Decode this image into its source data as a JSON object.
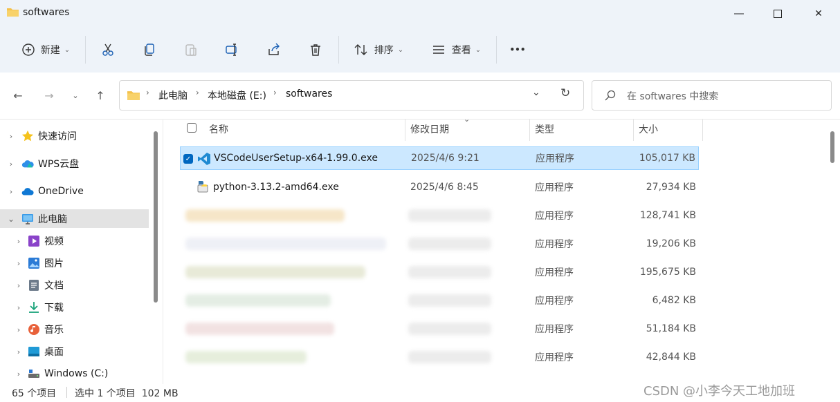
{
  "window": {
    "title": "softwares"
  },
  "toolbar": {
    "new_label": "新建",
    "sort_label": "排序",
    "view_label": "查看",
    "more_label": "•••"
  },
  "address": {
    "crumbs": [
      "此电脑",
      "本地磁盘 (E:)",
      "softwares"
    ],
    "search_placeholder": "在 softwares 中搜索"
  },
  "sidebar": {
    "items": [
      {
        "label": "快速访问",
        "icon": "star-icon"
      },
      {
        "label": "WPS云盘",
        "icon": "cloud-icon"
      },
      {
        "label": "OneDrive",
        "icon": "onedrive-icon"
      },
      {
        "label": "此电脑",
        "icon": "computer-icon"
      },
      {
        "label": "视频",
        "icon": "video-icon"
      },
      {
        "label": "图片",
        "icon": "picture-icon"
      },
      {
        "label": "文档",
        "icon": "document-icon"
      },
      {
        "label": "下载",
        "icon": "download-icon"
      },
      {
        "label": "音乐",
        "icon": "music-icon"
      },
      {
        "label": "桌面",
        "icon": "desktop-icon"
      },
      {
        "label": "Windows (C:)",
        "icon": "drive-icon"
      }
    ]
  },
  "columns": {
    "name": "名称",
    "date": "修改日期",
    "type": "类型",
    "size": "大小"
  },
  "files": [
    {
      "name": "VSCodeUserSetup-x64-1.99.0.exe",
      "date": "2025/4/6 9:21",
      "type": "应用程序",
      "size": "105,017 KB",
      "selected": true
    },
    {
      "name": "python-3.13.2-amd64.exe",
      "date": "2025/4/6 8:45",
      "type": "应用程序",
      "size": "27,934 KB",
      "selected": false
    },
    {
      "name": "",
      "date": "",
      "type": "应用程序",
      "size": "128,741 KB",
      "selected": false
    },
    {
      "name": "",
      "date": "",
      "type": "应用程序",
      "size": "19,206 KB",
      "selected": false
    },
    {
      "name": "",
      "date": "",
      "type": "应用程序",
      "size": "195,675 KB",
      "selected": false
    },
    {
      "name": "",
      "date": "",
      "type": "应用程序",
      "size": "6,482 KB",
      "selected": false
    },
    {
      "name": "",
      "date": "",
      "type": "应用程序",
      "size": "51,184 KB",
      "selected": false
    },
    {
      "name": "",
      "date": "",
      "type": "应用程序",
      "size": "42,844 KB",
      "selected": false
    }
  ],
  "status": {
    "count": "65 个项目",
    "selection": "选中 1 个项目  102 MB"
  },
  "watermark": "CSDN @小李今天工地加班",
  "colors": {
    "selection_bg": "#cce8ff",
    "accent": "#0067c0",
    "folder": "#f4c14b"
  }
}
